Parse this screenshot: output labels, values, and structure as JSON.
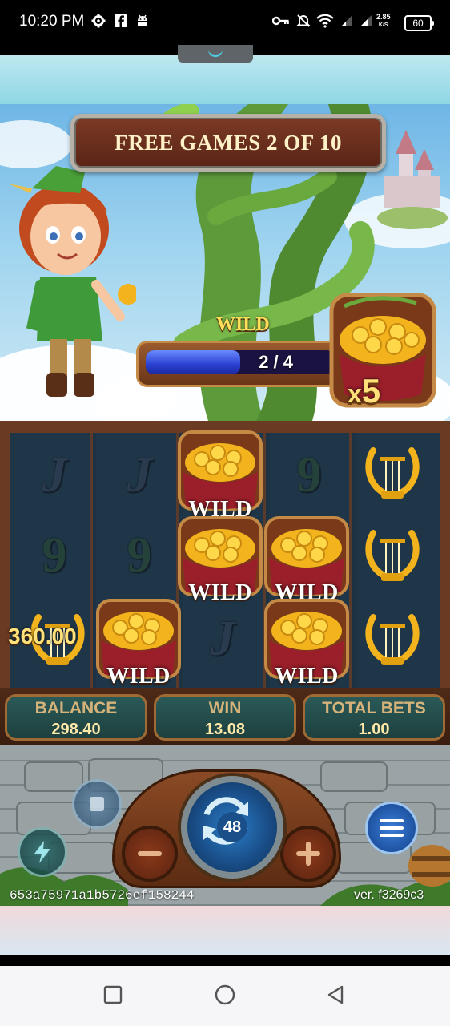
{
  "status_bar": {
    "time": "10:20 PM",
    "speed_value": "2.85",
    "speed_unit": "K/S",
    "battery": "60",
    "icons": [
      "gear-icon",
      "facebook-icon",
      "android-icon",
      "key-icon",
      "bell-off-icon",
      "wifi-icon",
      "signal-icon",
      "signal-icon"
    ]
  },
  "banner": {
    "text": "FREE GAMES 2 OF 10"
  },
  "wild_meter": {
    "label": "WILD",
    "value_text": "2 / 4",
    "progress_fraction": 0.5
  },
  "multiplier": {
    "x": "x",
    "value": "5"
  },
  "reels": {
    "columns": [
      {
        "symbols": [
          "J",
          "9",
          "lyre"
        ]
      },
      {
        "symbols": [
          "J",
          "9",
          "pot-wild"
        ]
      },
      {
        "symbols": [
          "pot-wild",
          "pot-wild",
          "J"
        ]
      },
      {
        "symbols": [
          "9",
          "pot-wild",
          "pot-wild"
        ]
      },
      {
        "symbols": [
          "lyre",
          "lyre",
          "lyre"
        ]
      }
    ],
    "wild_label": "WILD"
  },
  "win_amount": "360.00",
  "stats": {
    "balance_label": "BALANCE",
    "balance_value": "298.40",
    "win_label": "WIN",
    "win_value": "13.08",
    "bets_label": "TOTAL BETS",
    "bets_value": "1.00"
  },
  "controls": {
    "spin_count": "48",
    "icons": [
      "stop-icon",
      "lightning-icon",
      "spin-icon",
      "minus-icon",
      "plus-icon",
      "menu-icon"
    ]
  },
  "footer": {
    "session_id": "653a75971a1b5726ef158244",
    "version": "ver. f3269c3"
  },
  "colors": {
    "accent_gold": "#ffde5a",
    "panel_teal": "#2a5a58",
    "frame_brown": "#6b3a22"
  }
}
